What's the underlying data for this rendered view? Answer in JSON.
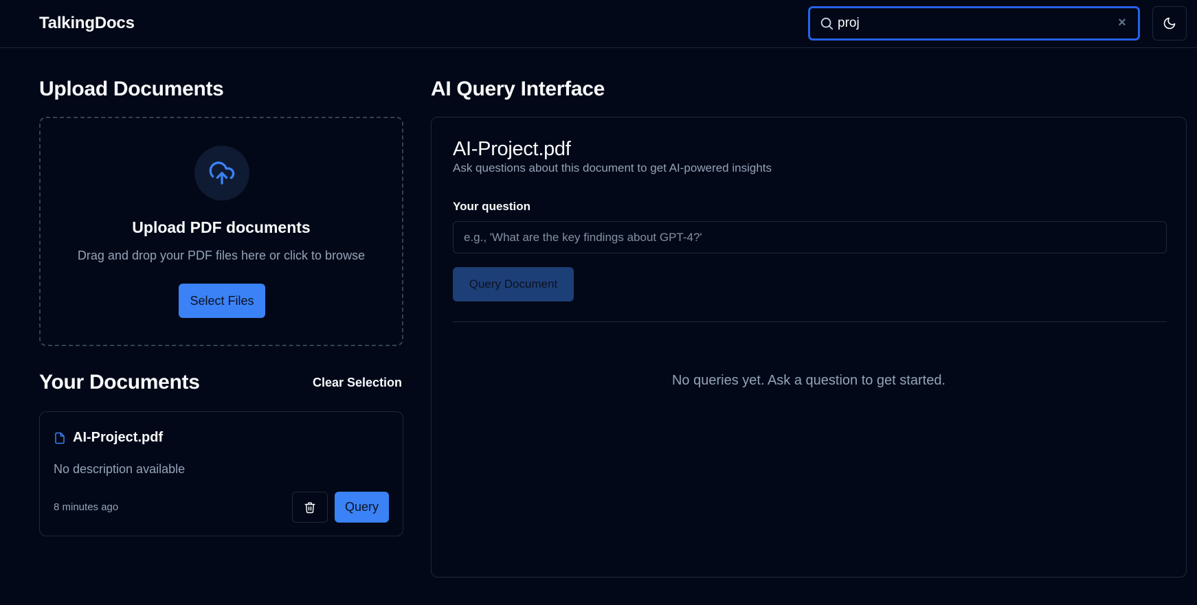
{
  "header": {
    "brand": "TalkingDocs",
    "search": {
      "value": "proj",
      "clear_icon": "×"
    },
    "theme_toggle_icon": "moon-icon"
  },
  "upload": {
    "heading": "Upload Documents",
    "title": "Upload PDF documents",
    "subtitle": "Drag and drop your PDF files here or click to browse",
    "select_label": "Select Files"
  },
  "documents": {
    "heading": "Your Documents",
    "clear_selection_label": "Clear Selection",
    "items": [
      {
        "name": "AI-Project.pdf",
        "description": "No description available",
        "time": "8 minutes ago",
        "query_label": "Query"
      }
    ]
  },
  "ai": {
    "heading": "AI Query Interface",
    "doc_title": "AI-Project.pdf",
    "doc_subtitle": "Ask questions about this document to get AI-powered insights",
    "question_label": "Your question",
    "question_placeholder": "e.g., 'What are the key findings about GPT-4?'",
    "submit_label": "Query Document",
    "empty_message": "No queries yet. Ask a question to get started."
  },
  "colors": {
    "background": "#020817",
    "accent": "#3b82f6",
    "accent_focus": "#2563eb",
    "border": "#1e293b",
    "muted_text": "#94a3b8"
  }
}
